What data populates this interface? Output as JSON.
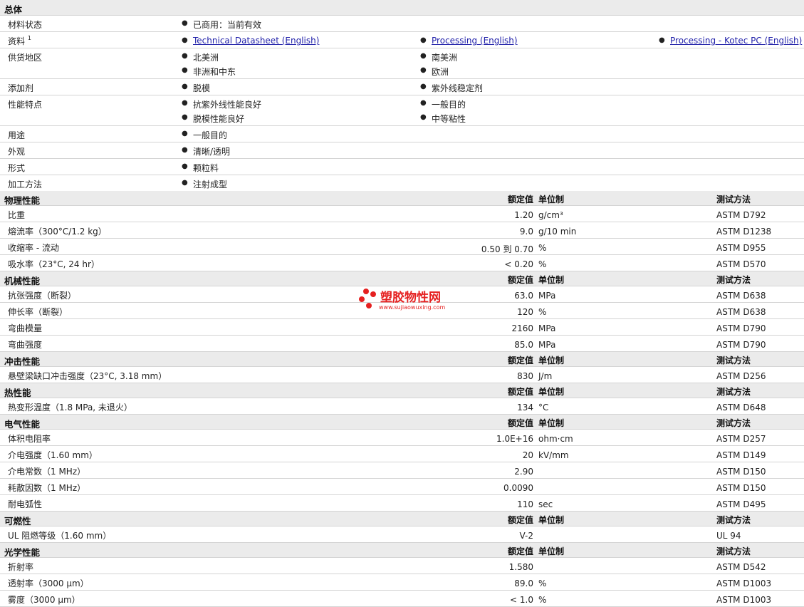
{
  "general": {
    "header": "总体",
    "status_label": "材料状态",
    "status_value": "已商用：当前有效",
    "docs_label": "资料",
    "docs_sup": "1",
    "docs": [
      "Technical Datasheet (English)",
      "Processing (English)",
      "Processing - Kotec PC (English)"
    ],
    "regions_label": "供货地区",
    "regions": [
      "北美洲",
      "南美洲",
      "非洲和中东",
      "欧洲"
    ],
    "additives_label": "添加剂",
    "additives": [
      "脱模",
      "紫外线稳定剂"
    ],
    "features_label": "性能特点",
    "features": [
      "抗紫外线性能良好",
      "一般目的",
      "脱模性能良好",
      "中等粘性"
    ],
    "uses_label": "用途",
    "uses": [
      "一般目的"
    ],
    "appearance_label": "外观",
    "appearance": [
      "清晰/透明"
    ],
    "form_label": "形式",
    "form": [
      "颗粒料"
    ],
    "processing_label": "加工方法",
    "processing": [
      "注射成型"
    ]
  },
  "columns": {
    "value": "额定值",
    "unit": "单位制",
    "method": "测试方法"
  },
  "sections": [
    {
      "title": "物理性能",
      "rows": [
        {
          "prop": "比重",
          "value": "1.20",
          "unit": "g/cm³",
          "method": "ASTM D792"
        },
        {
          "prop": "熔流率（300°C/1.2 kg）",
          "value": "9.0",
          "unit": "g/10 min",
          "method": "ASTM D1238"
        },
        {
          "prop": "收缩率 - 流动",
          "value": "0.50 到 0.70",
          "unit": "%",
          "method": "ASTM D955"
        },
        {
          "prop": "吸水率（23°C, 24 hr）",
          "value": "< 0.20",
          "unit": "%",
          "method": "ASTM D570"
        }
      ]
    },
    {
      "title": "机械性能",
      "rows": [
        {
          "prop": "抗张强度（断裂）",
          "value": "63.0",
          "unit": "MPa",
          "method": "ASTM D638"
        },
        {
          "prop": "伸长率（断裂）",
          "value": "120",
          "unit": "%",
          "method": "ASTM D638"
        },
        {
          "prop": "弯曲模量",
          "value": "2160",
          "unit": "MPa",
          "method": "ASTM D790"
        },
        {
          "prop": "弯曲强度",
          "value": "85.0",
          "unit": "MPa",
          "method": "ASTM D790"
        }
      ]
    },
    {
      "title": "冲击性能",
      "rows": [
        {
          "prop": "悬壁梁缺口冲击强度（23°C, 3.18 mm）",
          "value": "830",
          "unit": "J/m",
          "method": "ASTM D256"
        }
      ]
    },
    {
      "title": "热性能",
      "rows": [
        {
          "prop": "热变形温度（1.8 MPa, 未退火）",
          "value": "134",
          "unit": "°C",
          "method": "ASTM D648"
        }
      ]
    },
    {
      "title": "电气性能",
      "rows": [
        {
          "prop": "体积电阻率",
          "value": "1.0E+16",
          "unit": "ohm·cm",
          "method": "ASTM D257"
        },
        {
          "prop": "介电强度（1.60 mm）",
          "value": "20",
          "unit": "kV/mm",
          "method": "ASTM D149"
        },
        {
          "prop": "介电常数（1 MHz）",
          "value": "2.90",
          "unit": "",
          "method": "ASTM D150"
        },
        {
          "prop": "耗散因数（1 MHz）",
          "value": "0.0090",
          "unit": "",
          "method": "ASTM D150"
        },
        {
          "prop": "耐电弧性",
          "value": "110",
          "unit": "sec",
          "method": "ASTM D495"
        }
      ]
    },
    {
      "title": "可燃性",
      "rows": [
        {
          "prop": "UL 阻燃等级（1.60 mm）",
          "value": "V-2",
          "unit": "",
          "method": "UL 94"
        }
      ]
    },
    {
      "title": "光学性能",
      "rows": [
        {
          "prop": "折射率",
          "value": "1.580",
          "unit": "",
          "method": "ASTM D542"
        },
        {
          "prop": "透射率（3000 µm）",
          "value": "89.0",
          "unit": "%",
          "method": "ASTM D1003"
        },
        {
          "prop": "雾度（3000 µm）",
          "value": "< 1.0",
          "unit": "%",
          "method": "ASTM D1003"
        }
      ]
    }
  ],
  "watermark": {
    "text": "塑胶物性网",
    "url": "www.sujiaowuxing.com",
    "color": "#e52020"
  }
}
